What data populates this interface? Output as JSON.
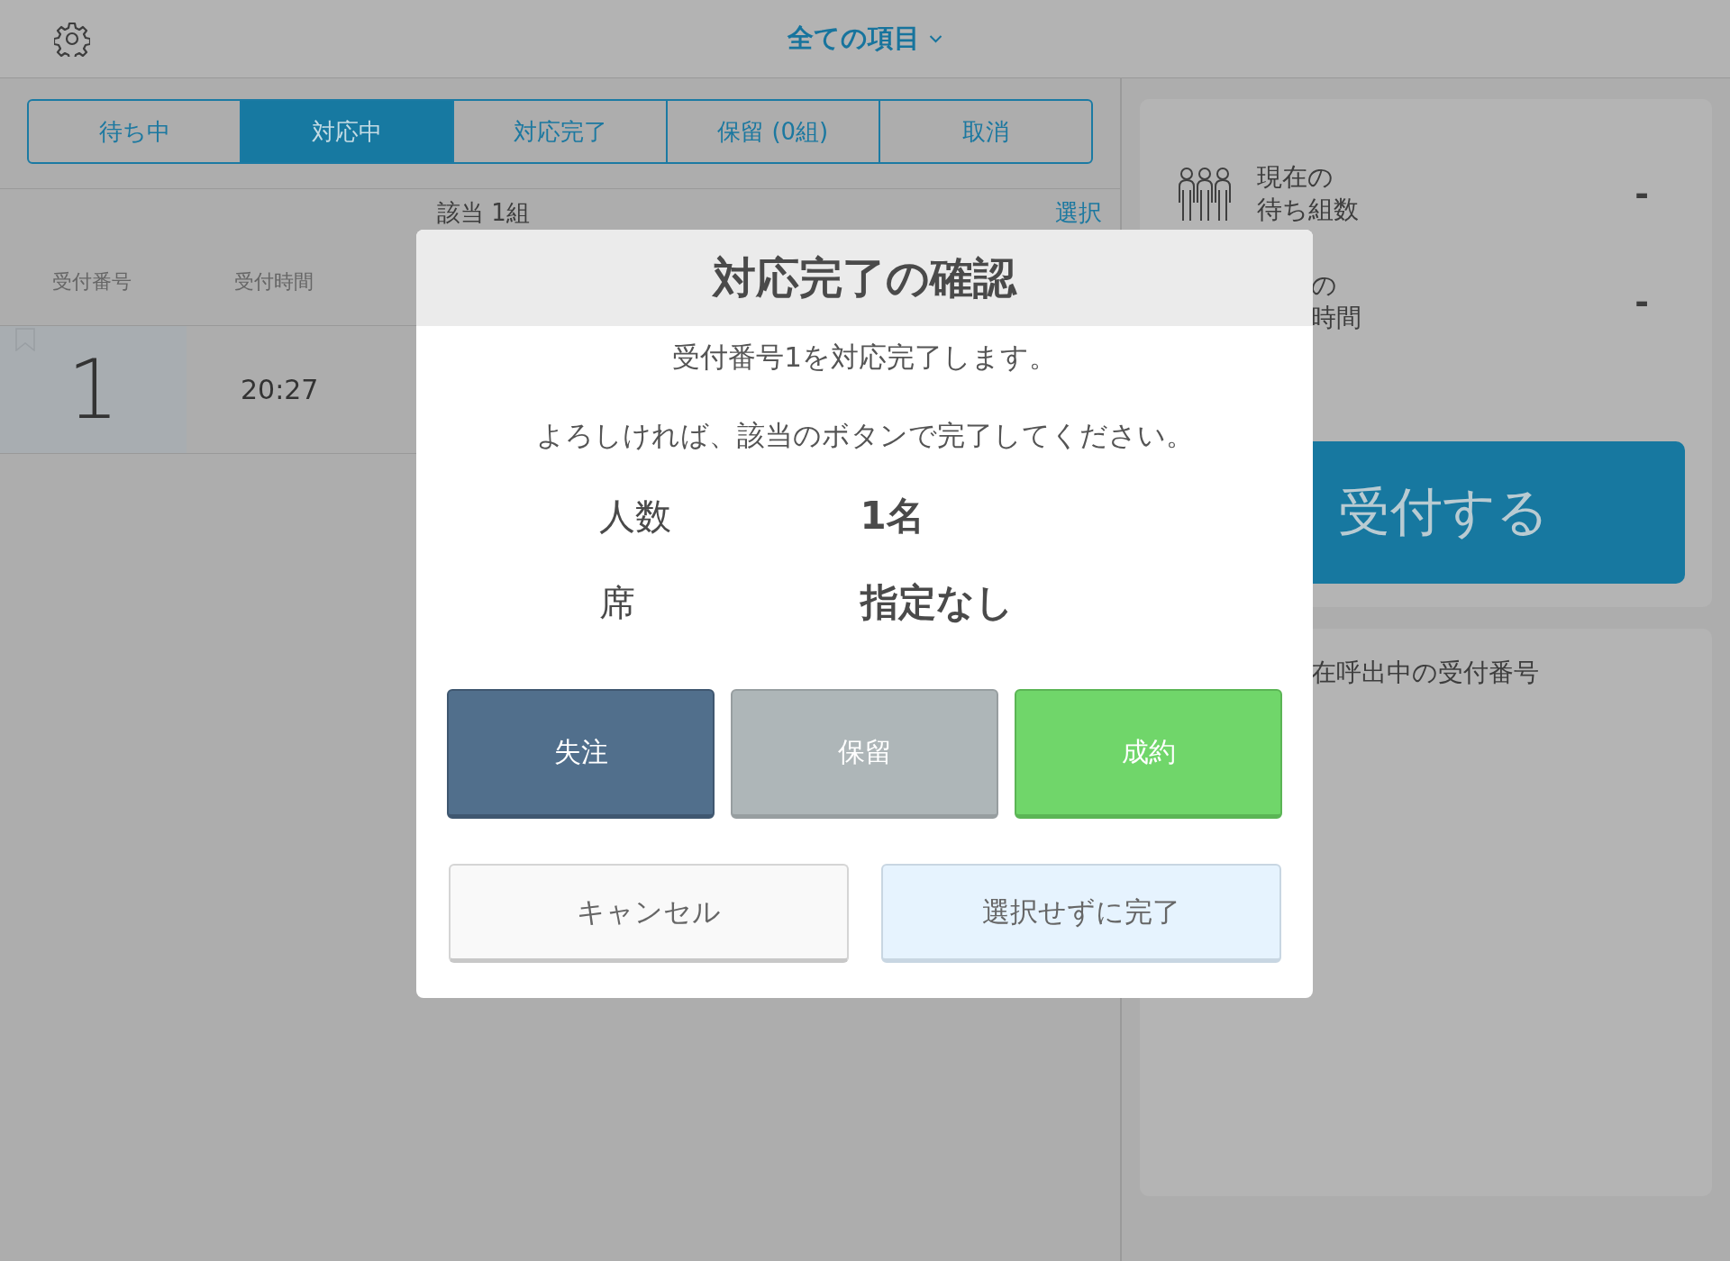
{
  "header": {
    "filter": "全ての項目"
  },
  "tabs": [
    {
      "label": "待ち中",
      "selected": false
    },
    {
      "label": "対応中",
      "selected": true
    },
    {
      "label": "対応完了",
      "selected": false
    },
    {
      "label": "保留 (0組)",
      "selected": false
    },
    {
      "label": "取消",
      "selected": false
    }
  ],
  "list": {
    "count": "該当 1組",
    "select_link": "選択",
    "columns": [
      "受付番号",
      "受付時間"
    ],
    "rows": [
      {
        "number": "1",
        "time": "20:27"
      }
    ]
  },
  "stats": [
    {
      "icon": true,
      "label_lines": [
        "現在の",
        "待ち組数"
      ],
      "value": "-"
    },
    {
      "icon": false,
      "label_lines": [
        "の",
        "時間"
      ],
      "value": "-"
    }
  ],
  "reception_button": "受付する",
  "calling": {
    "label": "在呼出中の受付番号"
  },
  "dialog": {
    "title": "対応完了の確認",
    "lines": [
      "受付番号1を対応完了します。",
      "よろしければ、該当のボタンで完了してください。"
    ],
    "details": [
      {
        "label": "人数",
        "value": "1名"
      },
      {
        "label": "席",
        "value": "指定なし"
      }
    ],
    "outcomes": [
      {
        "label": "失注",
        "kind": "lost"
      },
      {
        "label": "保留",
        "kind": "hold"
      },
      {
        "label": "成約",
        "kind": "won"
      }
    ],
    "actions": [
      {
        "label": "キャンセル",
        "kind": "cancel"
      },
      {
        "label": "選択せずに完了",
        "kind": "complete"
      }
    ]
  }
}
